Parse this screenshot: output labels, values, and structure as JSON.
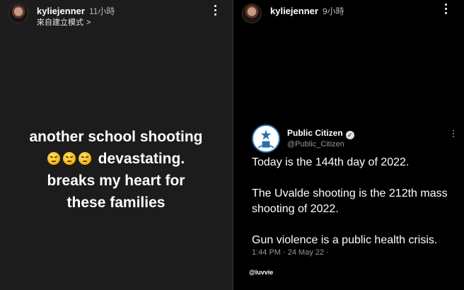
{
  "left_story": {
    "username": "kyliejenner",
    "time": "11小時",
    "subtitle": "來自建立模式",
    "text_line1": "another school shooting",
    "text_line2_suffix": "devastating.",
    "text_line3": "breaks my heart for",
    "text_line4": "these families",
    "emoji_count": 3,
    "emoji_name": "persevering-face-emoji"
  },
  "right_story": {
    "username": "kyliejenner",
    "time": "9小時",
    "tweet": {
      "name": "Public Citizen",
      "handle": "@Public_Citizen",
      "lines": [
        "Today is the 144th day of 2022.",
        "The Uvalde shooting is the 212th mass shooting of 2022.",
        "Gun violence is a public health crisis."
      ],
      "meta": "1:44 PM · 24 May 22 ·"
    },
    "credit": "@luvvie"
  }
}
